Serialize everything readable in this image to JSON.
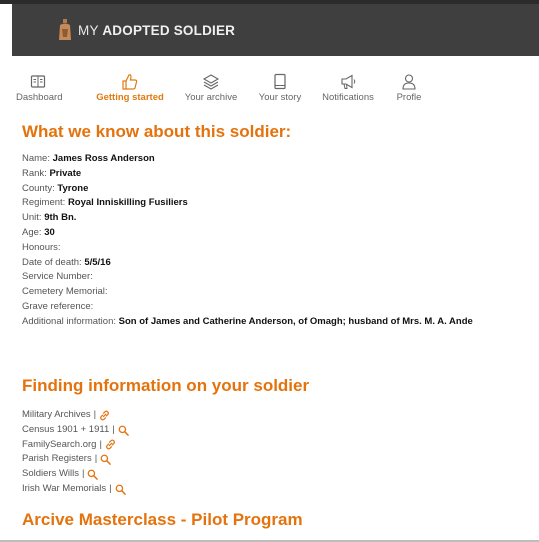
{
  "brand": {
    "prefix": "MY ",
    "name": "ADOPTED SOLDIER"
  },
  "nav": [
    {
      "label": "Dashboard",
      "icon": "dashboard-icon",
      "active": false
    },
    {
      "label": "Getting started",
      "icon": "thumbs-up-icon",
      "active": true
    },
    {
      "label": "Your archive",
      "icon": "layers-icon",
      "active": false
    },
    {
      "label": "Your story",
      "icon": "book-icon",
      "active": false
    },
    {
      "label": "Notifications",
      "icon": "megaphone-icon",
      "active": false
    },
    {
      "label": "Profle",
      "icon": "user-icon",
      "active": false
    }
  ],
  "facts_heading": "What we know about this soldier:",
  "facts": [
    {
      "label": "Name: ",
      "value": "James Ross Anderson"
    },
    {
      "label": "Rank: ",
      "value": "Private"
    },
    {
      "label": "County: ",
      "value": "Tyrone"
    },
    {
      "label": "Regiment: ",
      "value": "Royal Inniskilling Fusiliers"
    },
    {
      "label": "Unit: ",
      "value": "9th Bn."
    },
    {
      "label": "Age: ",
      "value": "30"
    },
    {
      "label": "Honours: ",
      "value": ""
    },
    {
      "label": "Date of death: ",
      "value": "5/5/16"
    },
    {
      "label": "Service Number: ",
      "value": ""
    },
    {
      "label": "Cemetery Memorial: ",
      "value": ""
    },
    {
      "label": "Grave reference: ",
      "value": ""
    },
    {
      "label": "Additional information: ",
      "value": "Son of James and Catherine Anderson, of Omagh; husband of Mrs. M. A. Ande"
    }
  ],
  "finding_heading": "Finding information on your soldier",
  "links": [
    {
      "label": "Military Archives",
      "sep": "|",
      "icon": "link-icon"
    },
    {
      "label": "Census 1901 + 1911",
      "sep": "|",
      "icon": "search-icon"
    },
    {
      "label": "FamilySearch.org",
      "sep": "|",
      "icon": "link-icon"
    },
    {
      "label": "Parish Registers",
      "sep": "|",
      "icon": "search-icon"
    },
    {
      "label": "Soldiers Wills",
      "sep": "|",
      "icon": "search-icon"
    },
    {
      "label": "Irish War Memorials",
      "sep": "|",
      "icon": "search-icon"
    }
  ],
  "masterclass_heading": "Arcive Masterclass - Pilot Program",
  "colors": {
    "accent": "#e4730d",
    "header_bg": "#3f3f3f",
    "text": "#555555"
  }
}
